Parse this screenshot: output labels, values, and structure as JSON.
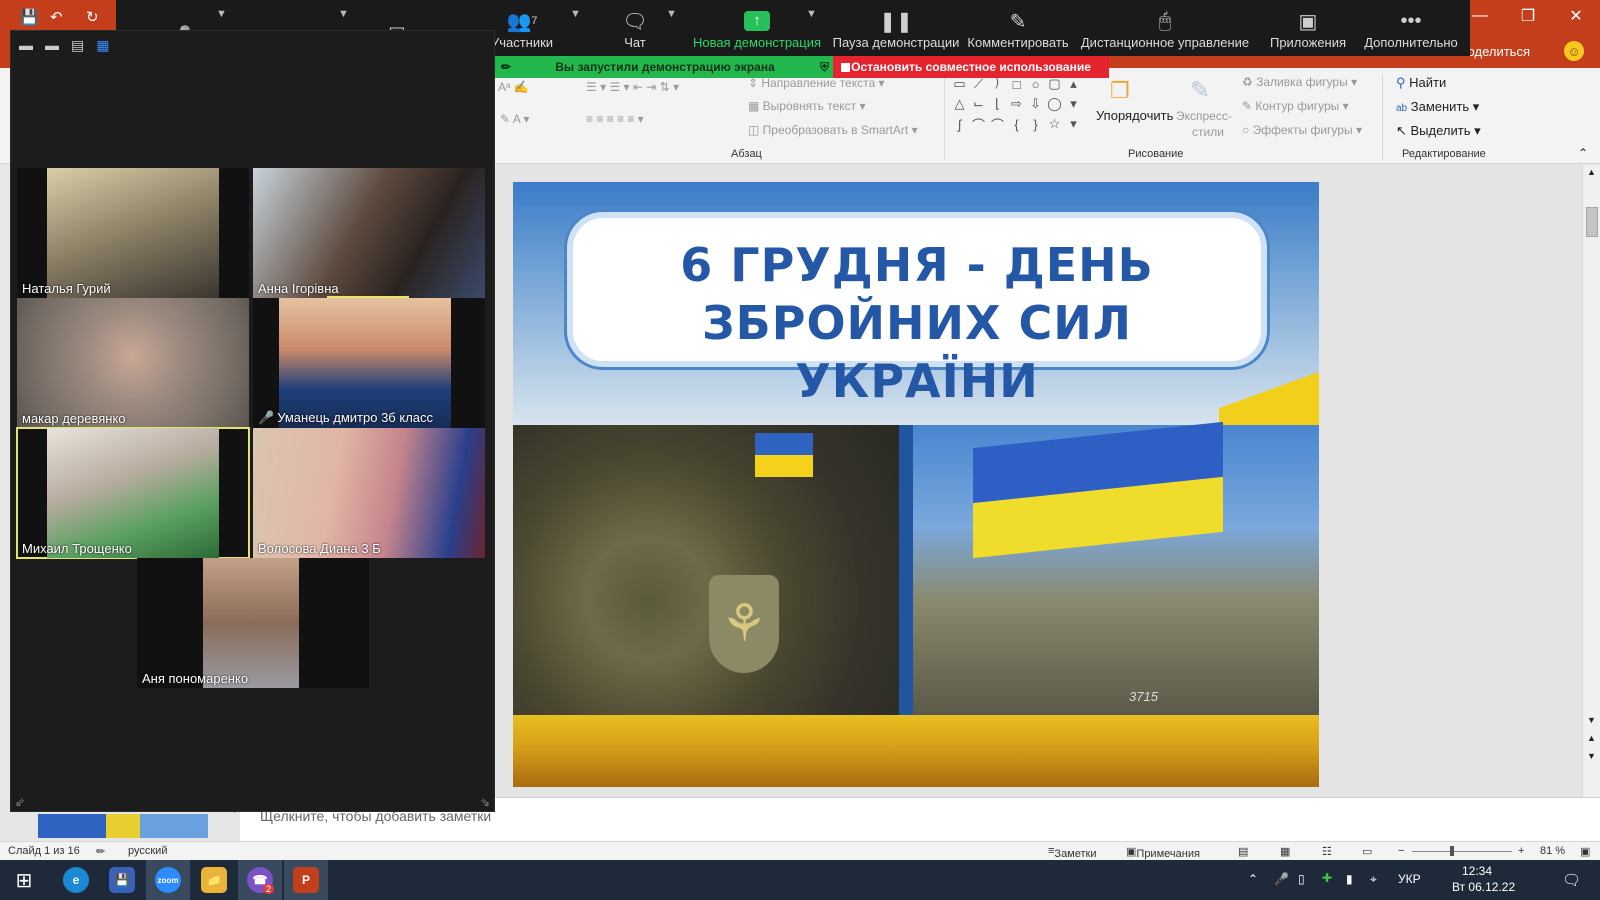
{
  "ppt": {
    "share_label": "Поделиться",
    "ribbon": {
      "paragraph": {
        "text_direction": "Направление текста",
        "align_text": "Выровнять текст",
        "convert_smartart": "Преобразовать в SmartArt",
        "group_label": "Абзац"
      },
      "drawing": {
        "arrange": "Упорядочить",
        "quick_styles_1": "Экспресс-",
        "quick_styles_2": "стили",
        "shape_fill": "Заливка фигуры",
        "shape_outline": "Контур фигуры",
        "shape_effects": "Эффекты фигуры",
        "group_label": "Рисование"
      },
      "editing": {
        "find": "Найти",
        "replace": "Заменить",
        "select": "Выделить",
        "group_label": "Редактирование"
      }
    },
    "slide": {
      "title_line1": "6 ГРУДНЯ - ДЕНЬ",
      "title_line2": "ЗБРОЙНИХ СИЛ УКРАЇНИ",
      "vehicle_number": "3715"
    },
    "notes_placeholder": "Щелкните, чтобы добавить заметки",
    "status": {
      "slide_counter": "Слайд 1 из 16",
      "language": "русский",
      "notes_btn": "Заметки",
      "comments_btn": "Примечания",
      "zoom": "81 %"
    }
  },
  "zoom": {
    "toolbar": {
      "participants_count": "7",
      "participants": "Участники",
      "chat": "Чат",
      "new_share": "Новая демонстрация",
      "pause_share": "Пауза демонстрации",
      "annotate": "Комментировать",
      "remote_control": "Дистанционное управление",
      "apps": "Приложения",
      "more": "Дополнительно"
    },
    "share_banner": "Вы запустили демонстрацию экрана",
    "stop_share": "Остановить совместное использование",
    "participants": [
      {
        "name": "Наталья Гурий"
      },
      {
        "name": "Анна Ігорівна"
      },
      {
        "name": "макар  деревянко"
      },
      {
        "name": "Уманець дмитро 3б класс"
      },
      {
        "name": "Михаил Трощенко"
      },
      {
        "name": "Волосова Диана 3 Б"
      },
      {
        "name": "Аня пономаренко"
      }
    ]
  },
  "taskbar": {
    "zoom_app": "zoom",
    "viber_badge": "2",
    "language": "УКР",
    "time": "12:34",
    "date": "Вт 06.12.22"
  }
}
